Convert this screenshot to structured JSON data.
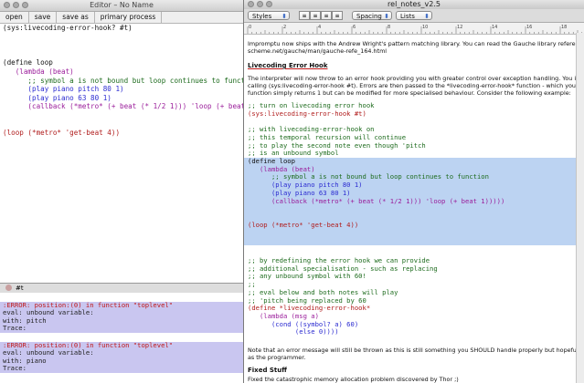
{
  "editor": {
    "title": "Editor – No Name",
    "toolbar": [
      "open",
      "save",
      "save as",
      "primary process"
    ],
    "code": {
      "l1": "(sys:livecoding-error-hook? #t)",
      "l2": "(define loop",
      "l3": "   (lambda (beat)",
      "l4": "      ;; symbol a is not bound but loop continues to function",
      "l5": "      (play piano pitch 80 1)",
      "l6": "      (play piano 63 80 1)",
      "l7": "      (callback (*metro* (+ beat (* 1/2 1))) 'loop (+ beat 1)))))",
      "l8": "(loop (*metro* 'get-beat 4))"
    }
  },
  "console": {
    "label": "#t",
    "errors": [
      {
        "head": ":ERROR: position:(0) in function \"toplevel\"",
        "l2": "eval: unbound variable:",
        "l3": "with: pitch",
        "l4": "Trace:"
      },
      {
        "head": ":ERROR: position:(0) in function \"toplevel\"",
        "l2": "eval: unbound variable:",
        "l3": "with: piano",
        "l4": "Trace:"
      }
    ]
  },
  "notes": {
    "title": "rel_notes_v2.5",
    "styles": "Styles",
    "spacing": "Spacing",
    "lists": "Lists",
    "ruler_labels": [
      "0",
      "2",
      "4",
      "6",
      "8",
      "10",
      "12",
      "14",
      "16",
      "18"
    ],
    "p1a": "Impromptu now ships with the Andrew Wright's pattern matching library.  You can read the Gauche library reference fo",
    "p1b": "scheme.net/gauche/man/gauche-refe_164.html",
    "h1": "Livecoding Error Hook",
    "p2a": "The interpreter will now throw to an error hook providing you with greater control over exception handling.  You initiat",
    "p2b": "calling (sys:livecoding-error-hook #t).  Errors are then passed to the *livecoding-error-hook* function - which you ma",
    "p2c": "function simply returns 1 but can be modified for more specialised behaviour.  Consider the following example:",
    "c1": ";; turn on livecoding error hook",
    "c2": "(sys:livecoding-error-hook #t)",
    "c3": ";; with livecoding-error-hook on",
    "c4": ";; this temporal recursion will continue",
    "c5": ";; to play the second note even though 'pitch",
    "c6": ";; is an unbound symbol",
    "c7": "(define loop",
    "c8": "   (lambda (beat)",
    "c9": "      ;; symbol a is not bound but loop continues to function",
    "c10": "      (play piano pitch 80 1)",
    "c11": "      (play piano 63 80 1)",
    "c12": "      (callback (*metro* (+ beat (* 1/2 1))) 'loop (+ beat 1)))))",
    "c13": "(loop (*metro* 'get-beat 4))",
    "d1": ";; by redefining the error hook we can provide",
    "d2": ";; additional specialisation - such as replacing",
    "d3": ";; any unbound symbol with 60!",
    "d4": ";;",
    "d5": ";; eval below and both notes will play",
    "d6": ";; 'pitch being replaced by 60",
    "d7": "(define *livecoding-error-hook*",
    "d8": "   (lambda (msg a)",
    "d9": "      (cond ((symbol? a) 60)",
    "d10": "            (else 0))))",
    "p3a": "Note that an error message will still be thrown as this is still something you SHOULD handle properly but hopefully at a",
    "p3b": "as the programmer.",
    "h2": "Fixed Stuff",
    "p4": "Fixed the catastrophic memory allocation problem discovered by Thor ;)"
  }
}
